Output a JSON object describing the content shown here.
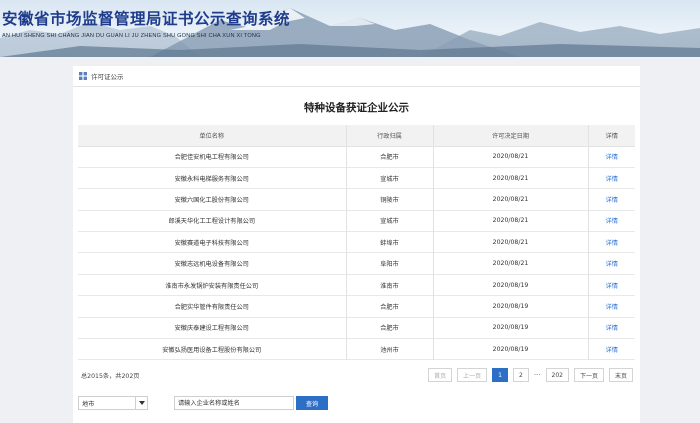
{
  "header": {
    "title": "安徽省市场监督管理局证书公示查询系统",
    "subtitle": "AN HUI SHENG SHI CHANG JIAN DU GUAN LI JU ZHENG SHU GONG SHI CHA XUN XI TONG"
  },
  "breadcrumb": {
    "label": "许可证公示"
  },
  "page_title": "特种设备获证企业公示",
  "table": {
    "columns": [
      "单位名称",
      "行政归属",
      "许可决定日期",
      "详情"
    ],
    "rows": [
      {
        "name": "合肥佳安机电工程有限公司",
        "region": "合肥市",
        "date": "2020/08/21",
        "detail": "详情"
      },
      {
        "name": "安徽永科电梯服务有限公司",
        "region": "宣城市",
        "date": "2020/08/21",
        "detail": "详情"
      },
      {
        "name": "安徽六国化工股份有限公司",
        "region": "铜陵市",
        "date": "2020/08/21",
        "detail": "详情"
      },
      {
        "name": "郎溪天华化工工程设计有限公司",
        "region": "宣城市",
        "date": "2020/08/21",
        "detail": "详情"
      },
      {
        "name": "安徽赛道电子科技有限公司",
        "region": "蚌埠市",
        "date": "2020/08/21",
        "detail": "详情"
      },
      {
        "name": "安徽志远机电设备有限公司",
        "region": "阜阳市",
        "date": "2020/08/21",
        "detail": "详情"
      },
      {
        "name": "淮南市永发锅炉安装有限责任公司",
        "region": "淮南市",
        "date": "2020/08/19",
        "detail": "详情"
      },
      {
        "name": "合肥实华管件有限责任公司",
        "region": "合肥市",
        "date": "2020/08/19",
        "detail": "详情"
      },
      {
        "name": "安徽庆泰建设工程有限公司",
        "region": "合肥市",
        "date": "2020/08/19",
        "detail": "详情"
      },
      {
        "name": "安徽弘扬医用设备工程股份有限公司",
        "region": "池州市",
        "date": "2020/08/19",
        "detail": "详情"
      }
    ]
  },
  "total_text": "总2015条，共202页",
  "pagination": {
    "first": "首页",
    "prev": "上一页",
    "page1": "1",
    "page2": "2",
    "ellipsis": "···",
    "last_page": "202",
    "next": "下一页",
    "end": "末页"
  },
  "filter": {
    "select_value": "地市",
    "search_placeholder": "请输入企业名称或姓名",
    "search_button": "查询"
  },
  "colors": {
    "brand_blue": "#2d6ec6",
    "link": "#2f6fd0",
    "title_blue": "#1f3c8c"
  },
  "icons": {
    "breadcrumb": "grid-icon",
    "dropdown": "caret-down-icon"
  }
}
